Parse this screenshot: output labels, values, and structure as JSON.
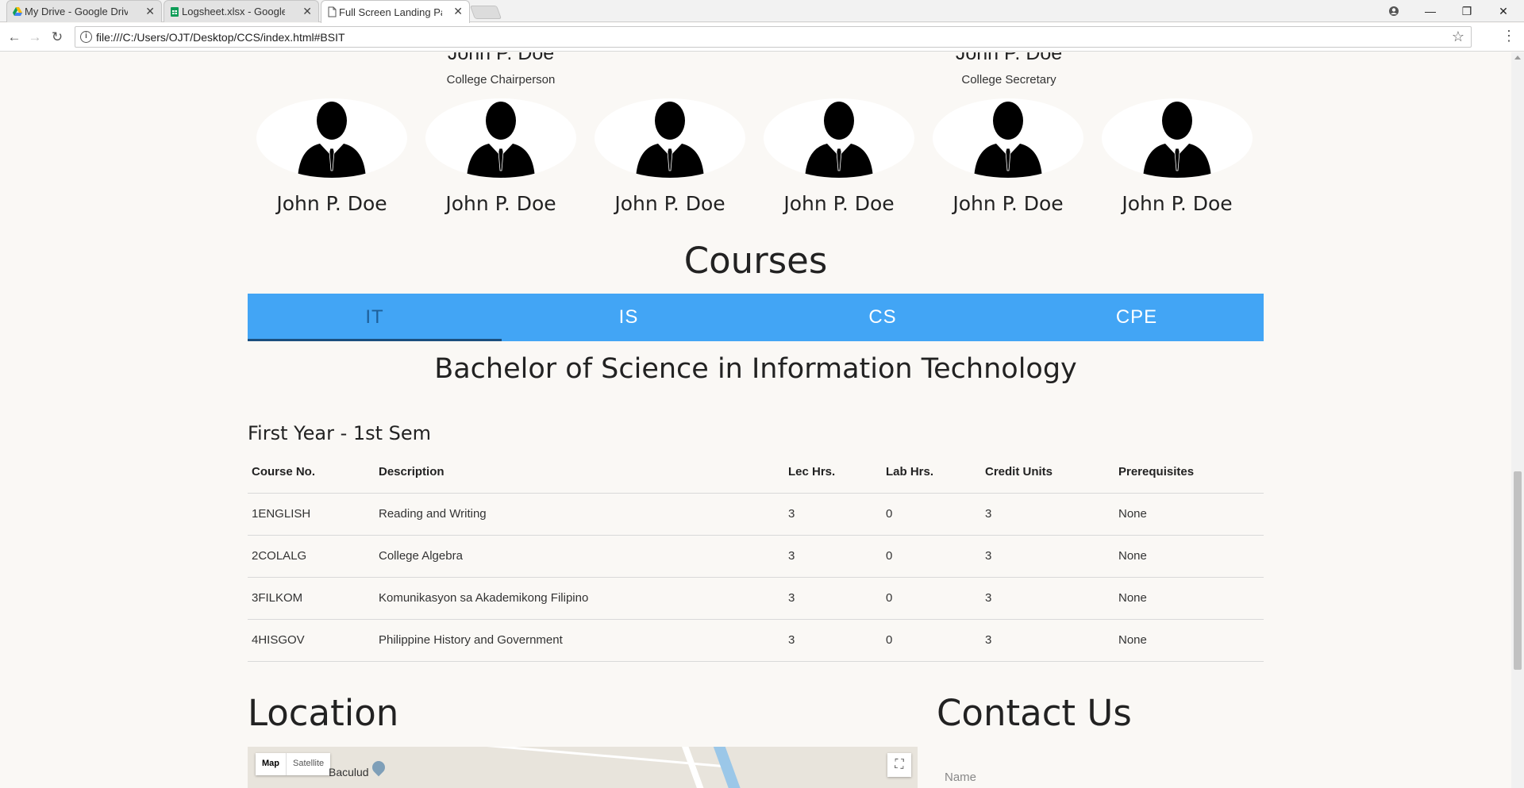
{
  "browser": {
    "tabs": [
      {
        "title": "My Drive - Google Drive"
      },
      {
        "title": "Logsheet.xlsx - Google Sheets"
      },
      {
        "title": "Full Screen Landing Page"
      }
    ],
    "url": "file:///C:/Users/OJT/Desktop/CCS/index.html#BSIT"
  },
  "officers": {
    "top_left": {
      "name": "John P. Doe",
      "role": "College Chairperson"
    },
    "top_right": {
      "name": "John P. Doe",
      "role": "College Secretary"
    }
  },
  "faculty": [
    {
      "name": "John P. Doe"
    },
    {
      "name": "John P. Doe"
    },
    {
      "name": "John P. Doe"
    },
    {
      "name": "John P. Doe"
    },
    {
      "name": "John P. Doe"
    },
    {
      "name": "John P. Doe"
    }
  ],
  "courses": {
    "title": "Courses",
    "tabs": [
      "IT",
      "IS",
      "CS",
      "CPE"
    ],
    "active_tab": "IT",
    "program_title": "Bachelor of Science in Information Technology",
    "semester_title": "First Year - 1st Sem",
    "columns": [
      "Course No.",
      "Description",
      "Lec Hrs.",
      "Lab Hrs.",
      "Credit Units",
      "Prerequisites"
    ],
    "rows": [
      [
        "1ENGLISH",
        "Reading and Writing",
        "3",
        "0",
        "3",
        "None"
      ],
      [
        "2COLALG",
        "College Algebra",
        "3",
        "0",
        "3",
        "None"
      ],
      [
        "3FILKOM",
        "Komunikasyon sa Akademikong Filipino",
        "3",
        "0",
        "3",
        "None"
      ],
      [
        "4HISGOV",
        "Philippine History and Government",
        "3",
        "0",
        "3",
        "None"
      ]
    ]
  },
  "location": {
    "title": "Location",
    "map_type_map": "Map",
    "map_type_satellite": "Satellite",
    "place": "Baculud"
  },
  "contact": {
    "title": "Contact Us",
    "name_placeholder": "Name"
  },
  "colors": {
    "tab_bar": "#42a5f5",
    "active_tab_text": "#1e5f99",
    "page_bg": "#faf8f5"
  }
}
